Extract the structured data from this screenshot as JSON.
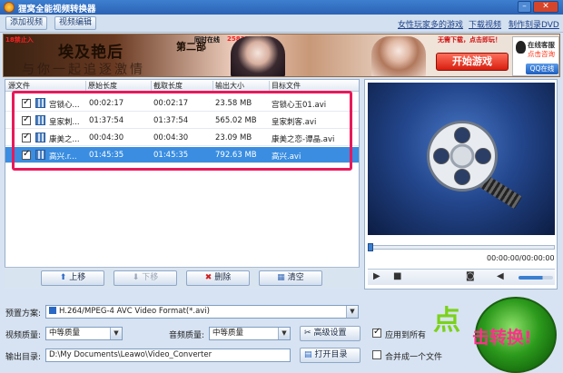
{
  "window": {
    "title": "狸窝全能视频转换器",
    "min_glyph": "–",
    "close_glyph": "✕"
  },
  "menubar": {
    "add_video": "添加视频",
    "edit_video": "视频编辑",
    "links": [
      "女性玩家多的游戏",
      "下载视频",
      "制作刻录DVD"
    ]
  },
  "banner": {
    "warn": "18禁止入",
    "online_prefix": "同时在线",
    "online_count": "25823",
    "online_suffix": "玩家",
    "free": "无需下载，点击即玩！",
    "calligraphy1": "埃及艳后",
    "calligraphy2": "第二部",
    "calligraphy3": "与你一起追逐激情",
    "play": "开始游戏",
    "cs_line1": "在线客服",
    "cs_line2": "点击咨询",
    "qq": "QQ在线"
  },
  "table": {
    "headers": [
      "源文件",
      "原始长度",
      "截取长度",
      "输出大小",
      "目标文件"
    ],
    "rows": [
      {
        "src": "宫锁心...",
        "orig": "00:02:17",
        "cut": "00:02:17",
        "size": "23.58 MB",
        "target": "宫锁心玉01.avi",
        "checked": true
      },
      {
        "src": "皇家刺...",
        "orig": "01:37:54",
        "cut": "01:37:54",
        "size": "565.02 MB",
        "target": "皇家刺客.avi",
        "checked": true
      },
      {
        "src": "康美之...",
        "orig": "00:04:30",
        "cut": "00:04:30",
        "size": "23.09 MB",
        "target": "康美之恋-谭晶.avi",
        "checked": true
      },
      {
        "src": "高兴.r...",
        "orig": "01:45:35",
        "cut": "01:45:35",
        "size": "792.63 MB",
        "target": "高兴.avi",
        "checked": true
      }
    ]
  },
  "list_buttons": {
    "up": "上移",
    "down": "下移",
    "delete": "删除",
    "clear": "清空"
  },
  "preview": {
    "time": "00:00:00/00:00:00"
  },
  "form": {
    "preset_label": "预置方案:",
    "preset_value": "H.264/MPEG-4 AVC Video Format(*.avi)",
    "vq_label": "视频质量:",
    "vq_value": "中等质量",
    "aq_label": "音频质量:",
    "aq_value": "中等质量",
    "advanced": "高级设置",
    "apply_all": "应用到所有",
    "out_label": "输出目录:",
    "out_value": "D:\\My Documents\\Leawo\\Video_Converter",
    "open_dir": "打开目录",
    "merge": "合并成一个文件"
  },
  "convert": {
    "big": "点",
    "rest": "击转换!"
  },
  "colors": {
    "highlight": "#e8195a",
    "selected_row": "#3a8de0",
    "titlebar": "#2b62b4"
  }
}
